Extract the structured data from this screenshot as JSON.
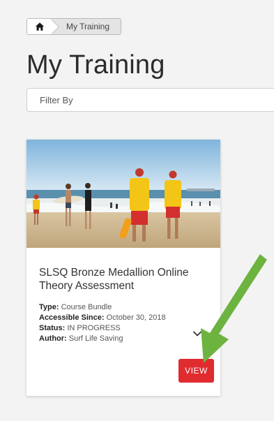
{
  "breadcrumb": {
    "home_icon": "home-icon",
    "current": "My Training"
  },
  "page": {
    "title": "My Training"
  },
  "filter": {
    "label": "Filter By"
  },
  "course_card": {
    "title": "SLSQ Bronze Medallion Online Theory Assessment",
    "type_label": "Type:",
    "type_value": "Course Bundle",
    "accessible_label": "Accessible Since:",
    "accessible_value": "October 30, 2018",
    "status_label": "Status:",
    "status_value": "IN PROGRESS",
    "author_label": "Author:",
    "author_value": "Surf Life Saving",
    "expand_icon": "chevron-down-icon",
    "view_label": "VIEW",
    "view_color": "#e02b2f"
  },
  "annotation": {
    "arrow_color": "#6cb33f"
  }
}
